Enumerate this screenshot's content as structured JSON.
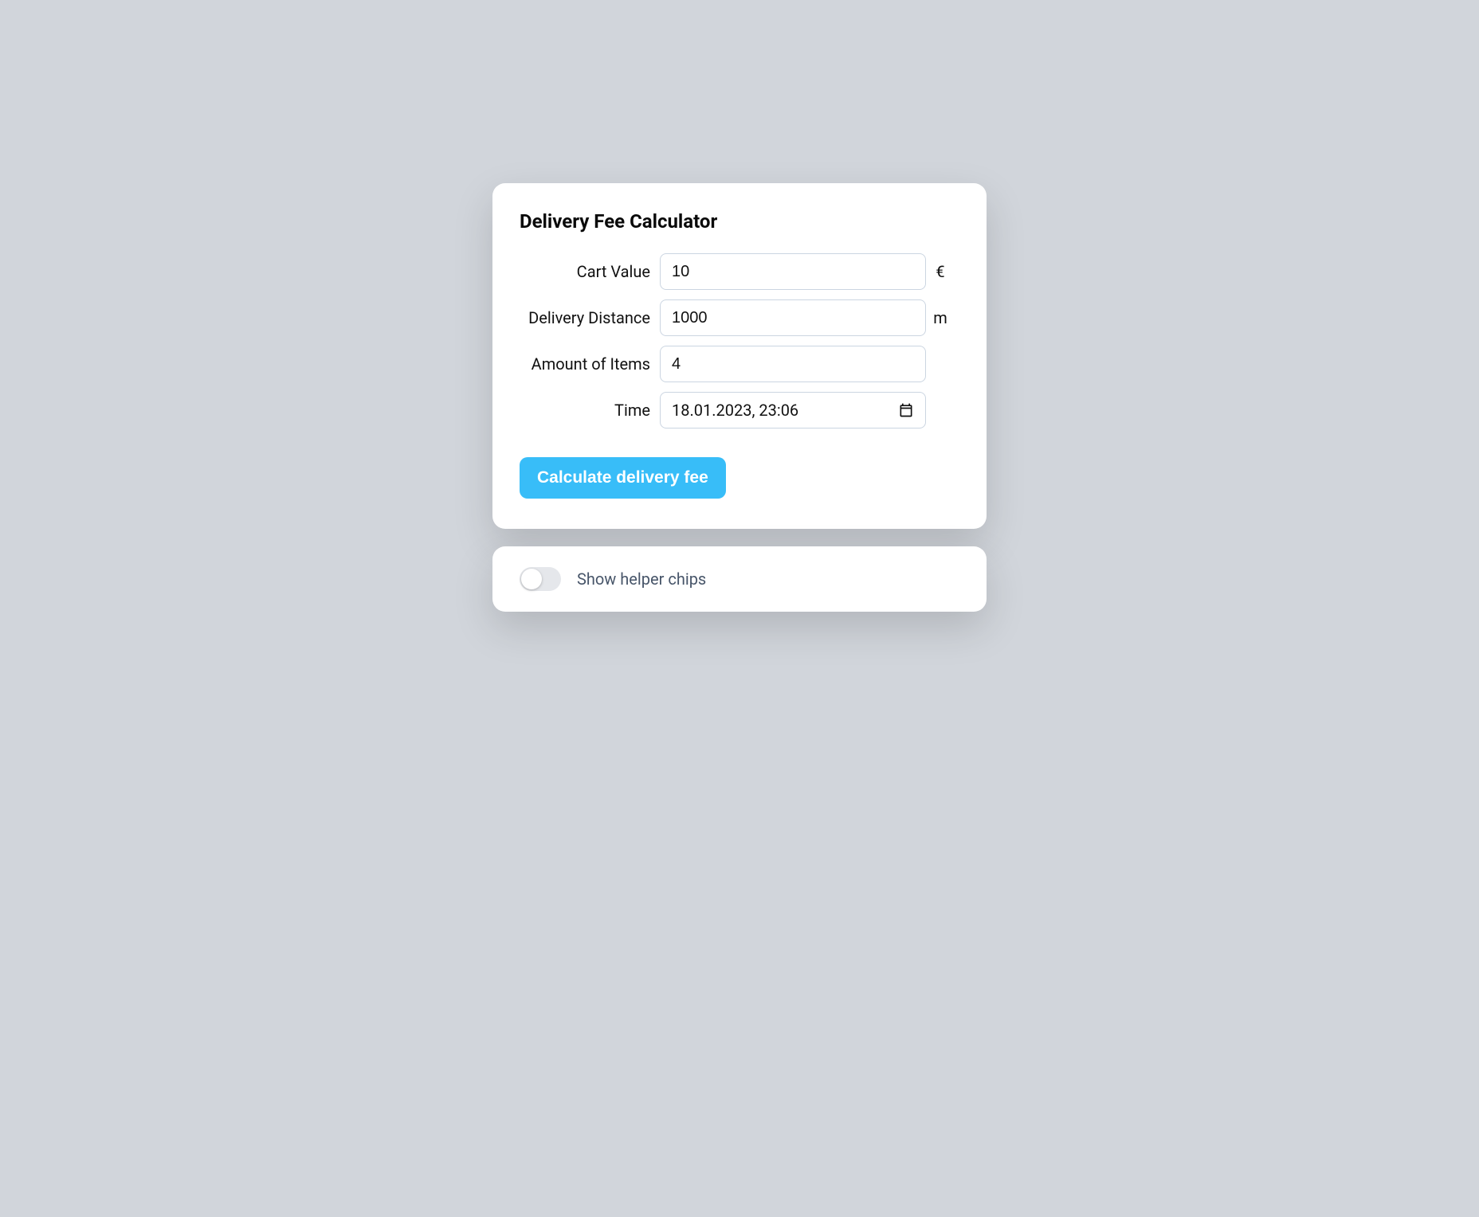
{
  "title": "Delivery Fee Calculator",
  "form": {
    "cart_value": {
      "label": "Cart Value",
      "value": "10",
      "unit": "€"
    },
    "delivery_distance": {
      "label": "Delivery Distance",
      "value": "1000",
      "unit": "m"
    },
    "amount_of_items": {
      "label": "Amount of Items",
      "value": "4"
    },
    "time": {
      "label": "Time",
      "value": "18.01.2023, 23:06"
    }
  },
  "button_label": "Calculate delivery fee",
  "helper_toggle": {
    "label": "Show helper chips",
    "on": false
  }
}
